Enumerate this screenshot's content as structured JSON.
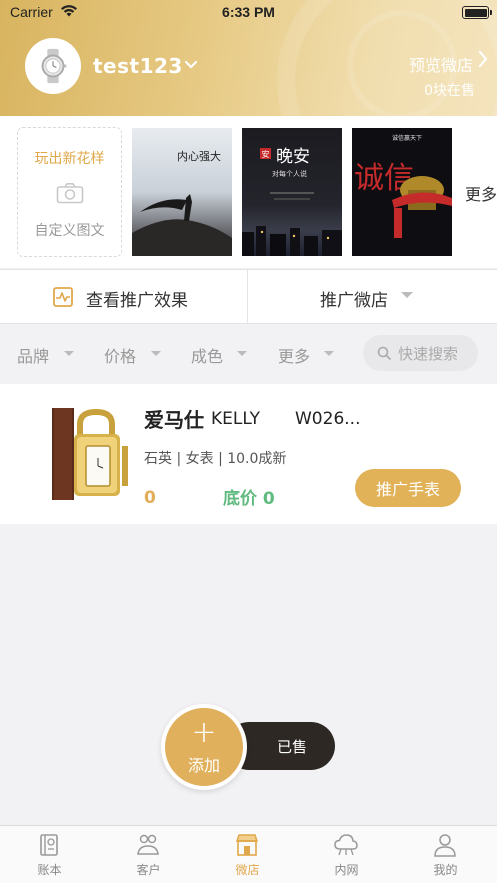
{
  "status_bar": {
    "carrier": "Carrier",
    "time": "6:33 PM"
  },
  "header": {
    "username": "test123",
    "preview_label": "预览微店",
    "on_sale_count": "0块在售"
  },
  "templates": {
    "custom_title": "玩出新花样",
    "custom_label": "自定义图文",
    "more_label": "更多",
    "posters": [
      {
        "name": "poster-1",
        "text_main": "内心强大",
        "colors": [
          "#e8ecf0",
          "#2b2a2a"
        ]
      },
      {
        "name": "poster-2",
        "text_main": "晚安",
        "text_sub": "对每个人说",
        "text_tag": "安"
      },
      {
        "name": "poster-3",
        "text_main": "诚信",
        "text_top": "诚信赢天下"
      }
    ]
  },
  "actions": {
    "view_effect": "查看推广效果",
    "promote_shop": "推广微店"
  },
  "filters": {
    "brand": "品牌",
    "price": "价格",
    "condition": "成色",
    "more": "更多",
    "search_placeholder": "快速搜索"
  },
  "product": {
    "brand": "爱马仕",
    "model": "KELLY",
    "code": "W026...",
    "spec": "石英 | 女表 | 10.0成新",
    "price": "0",
    "floor_price": "底价 0",
    "promote_button": "推广手表"
  },
  "floating": {
    "add_label": "添加",
    "sold_label": "已售"
  },
  "tabbar": {
    "items": [
      {
        "label": "账本",
        "icon": "ledger-icon",
        "active": false
      },
      {
        "label": "客户",
        "icon": "customers-icon",
        "active": false
      },
      {
        "label": "微店",
        "icon": "shop-icon",
        "active": true
      },
      {
        "label": "内网",
        "icon": "cloud-icon",
        "active": false
      },
      {
        "label": "我的",
        "icon": "profile-icon",
        "active": false
      }
    ]
  },
  "colors": {
    "accent": "#e0b05c",
    "floor_price_green": "#61bb80",
    "sold_button_bg": "#2d2824"
  }
}
